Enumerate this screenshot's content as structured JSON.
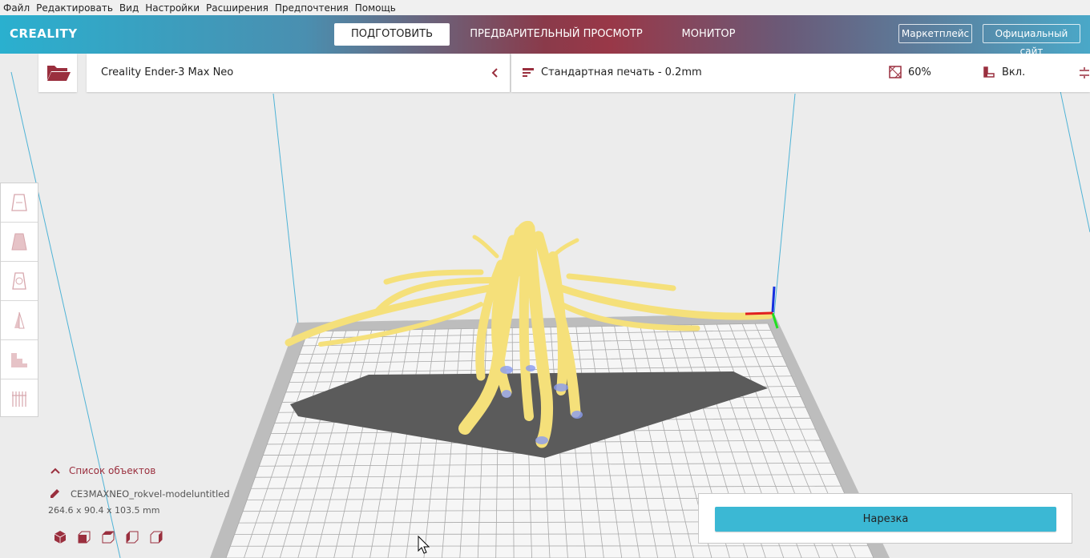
{
  "menu": [
    "Файл",
    "Редактировать",
    "Вид",
    "Настройки",
    "Расширения",
    "Предпочтения",
    "Помощь"
  ],
  "brand": "CREALITY",
  "tabs": {
    "prepare": "ПОДГОТОВИТЬ",
    "preview": "ПРЕДВАРИТЕЛЬНЫЙ ПРОСМОТР",
    "monitor": "МОНИТОР"
  },
  "header_buttons": {
    "marketplace": "Маркетплейс",
    "official_site": "Официальный сайт"
  },
  "printer": {
    "name": "Creality Ender-3 Max Neo"
  },
  "print_settings": {
    "profile": "Стандартная печать - 0.2mm",
    "infill": "60%",
    "support": "Вкл."
  },
  "objects": {
    "header": "Список объектов",
    "name": "CE3MAXNEO_rokvel-modeluntitled",
    "dimensions": "264.6 x 90.4 x 103.5 mm"
  },
  "slice_button": "Нарезка",
  "colors": {
    "accent": "#3bb8d4",
    "brand_red": "#993848",
    "model": "#f7e27a",
    "shadow": "#5a5a5a"
  }
}
